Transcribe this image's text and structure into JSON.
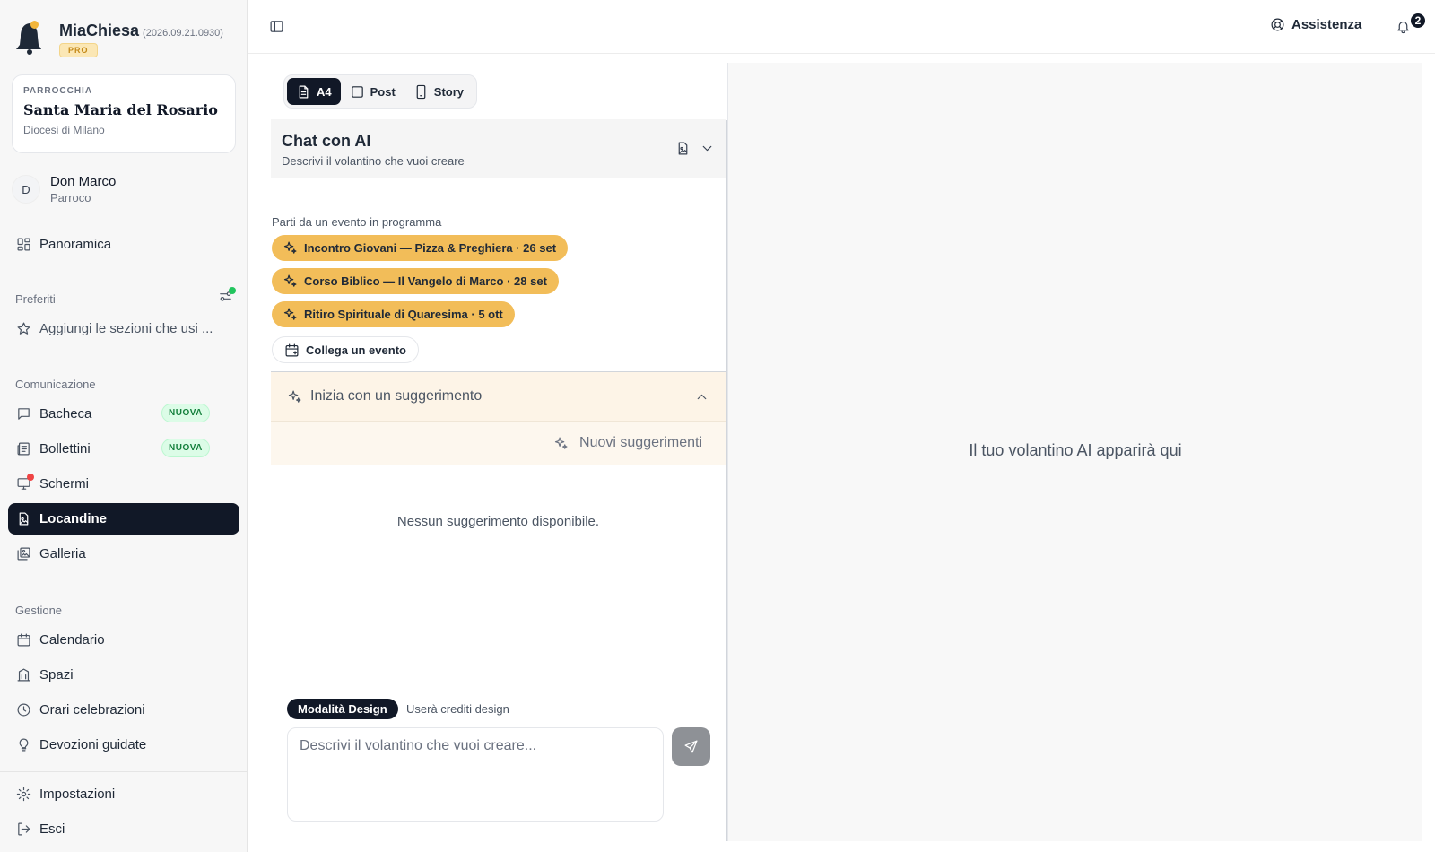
{
  "app": {
    "name": "MiaChiesa",
    "version": "(2026.09.21.0930)",
    "plan_badge": "PRO"
  },
  "parish": {
    "kicker": "PARROCCHIA",
    "name": "Santa Maria del Rosario",
    "diocese": "Diocesi di Milano"
  },
  "user": {
    "initial": "D",
    "name": "Don Marco",
    "role": "Parroco"
  },
  "nav": {
    "overview": "Panoramica",
    "favorites_title": "Preferiti",
    "favorites_empty": "Aggiungi le sezioni che usi ...",
    "communication_title": "Comunicazione",
    "board": "Bacheca",
    "board_badge": "NUOVA",
    "bulletins": "Bollettini",
    "bulletins_badge": "NUOVA",
    "screens": "Schermi",
    "posters": "Locandine",
    "gallery": "Galleria",
    "management_title": "Gestione",
    "calendar": "Calendario",
    "spaces": "Spazi",
    "mass_times": "Orari celebrazioni",
    "devotions": "Devozioni guidate",
    "settings": "Impostazioni",
    "logout": "Esci"
  },
  "topbar": {
    "help_label": "Assistenza",
    "notifications_count": "2"
  },
  "formats": [
    {
      "label": "A4",
      "active": true
    },
    {
      "label": "Post",
      "active": false
    },
    {
      "label": "Story",
      "active": false
    }
  ],
  "chat": {
    "title": "Chat con AI",
    "subtitle": "Descrivi il volantino che vuoi creare",
    "events_label": "Parti da un evento in programma",
    "events": [
      "Incontro Giovani — Pizza & Preghiera · 26 set",
      "Corso Biblico — Il Vangelo di Marco · 28 set",
      "Ritiro Spirituale di Quaresima · 5 ott"
    ],
    "link_event": "Collega un evento",
    "suggestions_title": "Inizia con un suggerimento",
    "new_suggestions": "Nuovi suggerimenti",
    "no_suggestions": "Nessun suggerimento disponibile.",
    "design_mode": "Modalità Design",
    "design_credits": "Userà crediti design",
    "prompt_placeholder": "Descrivi il volantino che vuoi creare..."
  },
  "preview": {
    "empty_text": "Il tuo volantino AI apparirà qui"
  },
  "colors": {
    "accent_dark": "#111827",
    "chip_gold": "#f2bd59",
    "new_badge": "#15803d",
    "online": "#22c55e",
    "alert": "#ef4444"
  }
}
